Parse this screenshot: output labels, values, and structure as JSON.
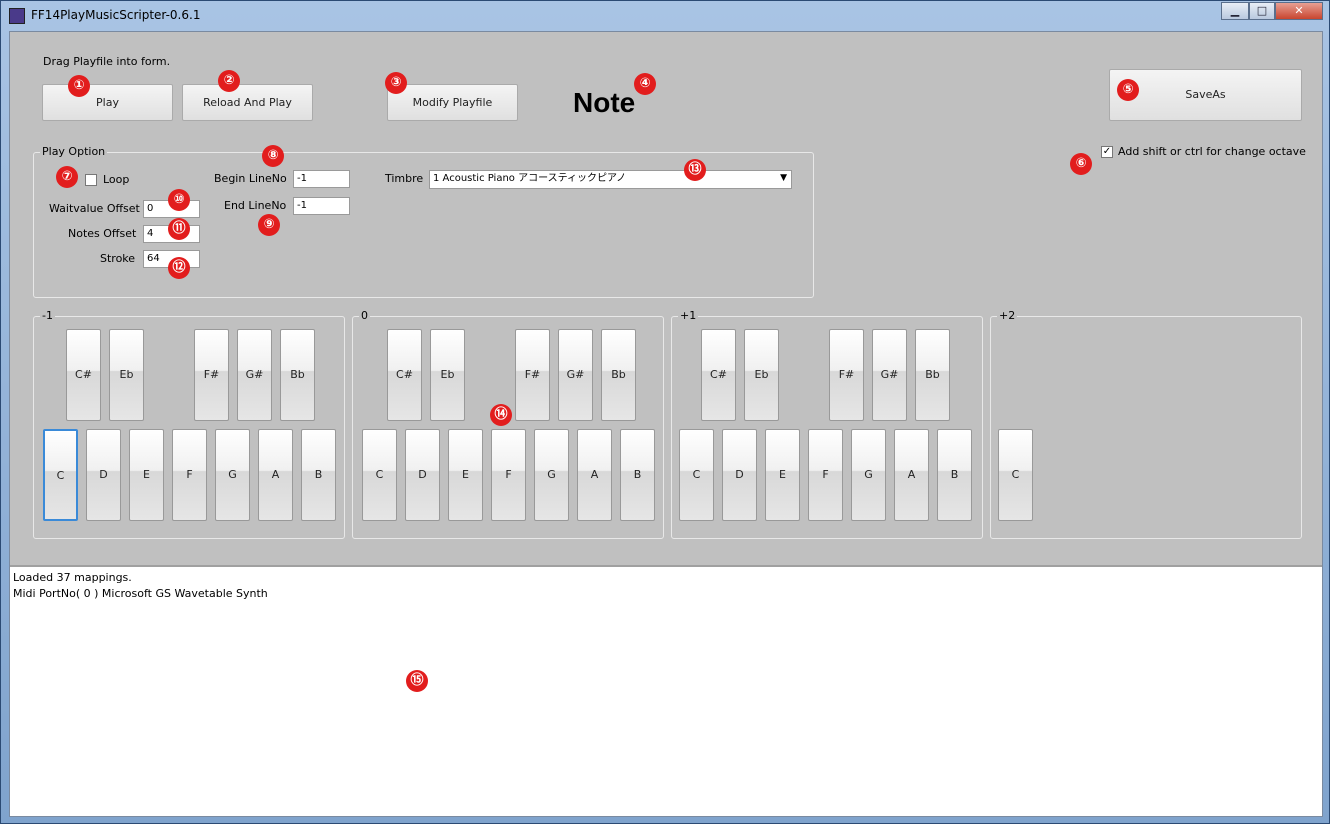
{
  "window": {
    "title": "FF14PlayMusicScripter-0.6.1",
    "minimize": "▁",
    "maximize": "□",
    "close": "✕"
  },
  "hint": "Drag Playfile into form.",
  "buttons": {
    "play": "Play",
    "reload": "Reload And Play",
    "modify": "Modify Playfile",
    "saveas": "SaveAs"
  },
  "note_label": "Note",
  "shift_option": {
    "label": "Add shift or ctrl for change octave",
    "checked": "✓"
  },
  "play_option": {
    "title": "Play Option",
    "loop_label": "Loop",
    "waitvalue_label": "Waitvalue Offset",
    "waitvalue": "0",
    "notes_offset_label": "Notes Offset",
    "notes_offset": "4",
    "stroke_label": "Stroke",
    "stroke": "64",
    "begin_label": "Begin LineNo",
    "begin": "-1",
    "end_label": "End LineNo",
    "end": "-1",
    "timbre_label": "Timbre",
    "timbre": "1   Acoustic Piano  アコースティックピアノ"
  },
  "octaves": [
    {
      "label": "-1",
      "black": [
        "C#",
        "Eb",
        "F#",
        "G#",
        "Bb"
      ],
      "white": [
        "C",
        "D",
        "E",
        "F",
        "G",
        "A",
        "B"
      ]
    },
    {
      "label": "0",
      "black": [
        "C#",
        "Eb",
        "F#",
        "G#",
        "Bb"
      ],
      "white": [
        "C",
        "D",
        "E",
        "F",
        "G",
        "A",
        "B"
      ]
    },
    {
      "label": "+1",
      "black": [
        "C#",
        "Eb",
        "F#",
        "G#",
        "Bb"
      ],
      "white": [
        "C",
        "D",
        "E",
        "F",
        "G",
        "A",
        "B"
      ]
    },
    {
      "label": "+2",
      "black": [],
      "white": [
        "C"
      ]
    }
  ],
  "log": [
    "Loaded 37 mappings.",
    "Midi PortNo( 0 ) Microsoft GS Wavetable Synth"
  ],
  "markers": [
    "①",
    "②",
    "③",
    "④",
    "⑤",
    "⑥",
    "⑦",
    "⑧",
    "⑨",
    "⑩",
    "⑪",
    "⑫",
    "⑬",
    "⑭",
    "⑮"
  ],
  "colors": {
    "marker": "#e21d1d",
    "client_bg": "#c0c0c0",
    "titlebar": "#a9c4e4"
  }
}
